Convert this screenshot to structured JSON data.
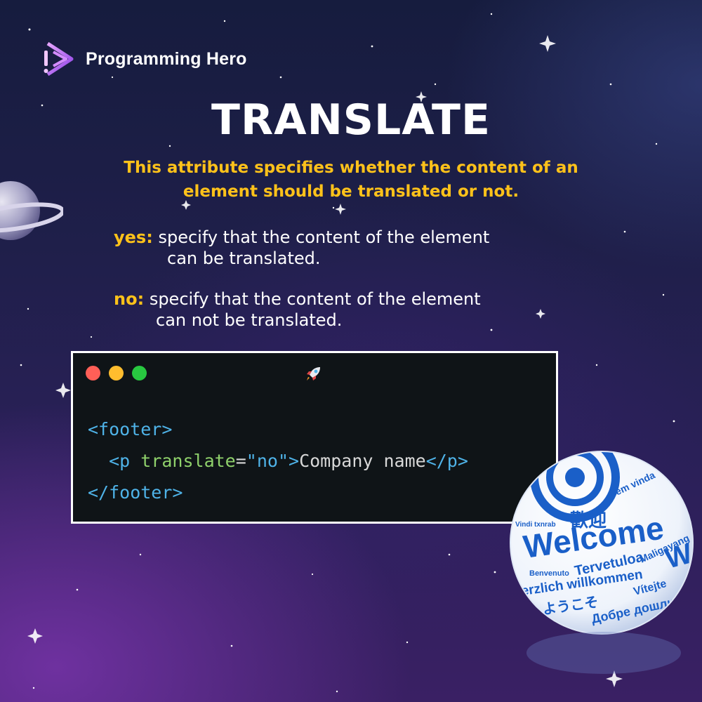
{
  "brand": {
    "name": "Programming Hero",
    "logo_icon": "play-exclamation-logo-icon"
  },
  "title": "TRANSLATE",
  "subtitle": "This attribute specifies whether the content of an element should be translated or not.",
  "definitions": [
    {
      "key": "yes:",
      "line1": "specify that the content of the element",
      "line2": "can be translated."
    },
    {
      "key": "no:",
      "line1": "specify that the content of the element",
      "line2": "can not be translated."
    }
  ],
  "code_window": {
    "rocket_icon": "rocket-icon",
    "lines": {
      "l1_open": "<footer>",
      "l2_indent": "  ",
      "l2_tag_open": "<p ",
      "l2_attr": "translate",
      "l2_eq": "=",
      "l2_val": "\"no\"",
      "l2_close_bracket": ">",
      "l2_text": "Company name",
      "l2_tag_close": "</p>",
      "l3_close": "</footer>"
    }
  },
  "globe": {
    "words": [
      "Welcome",
      "歡迎",
      "Bem vinda",
      "Tervetuloa",
      "Maligayang",
      "Herzlich willkommen",
      "Vítejte",
      "ようこそ",
      "Добре дошли",
      "Benvenuto",
      "Vindi txnrab",
      "Welc"
    ]
  },
  "colors": {
    "accent": "#ffc21a",
    "code_bg": "#0f1417",
    "tag": "#4fb3e8",
    "attr": "#8fd16b"
  }
}
